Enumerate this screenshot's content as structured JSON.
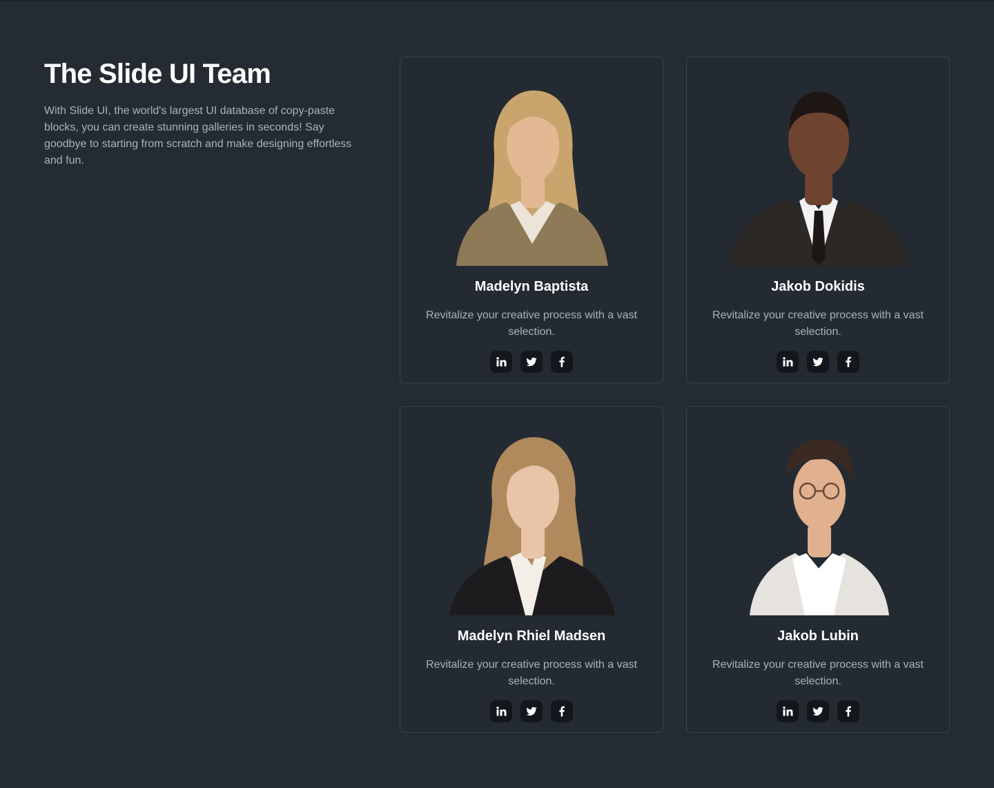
{
  "header": {
    "title": "The Slide UI Team",
    "description": "With Slide UI, the world's largest UI database of copy-paste blocks, you can create stunning galleries in seconds! Say goodbye to starting from scratch and make designing effortless and fun."
  },
  "team": [
    {
      "name": "Madelyn Baptista",
      "description": "Revitalize your creative process with a vast selection.",
      "portrait": {
        "hair": "#c9a56d",
        "skin": "#e3b994",
        "clothing": "#8e7a57",
        "inner": "#ece4d8"
      }
    },
    {
      "name": "Jakob Dokidis",
      "description": "Revitalize your creative process with a vast selection.",
      "portrait": {
        "hair": "#1d1612",
        "skin": "#6e4330",
        "clothing": "#2b2826",
        "inner": "#f2f2f2"
      }
    },
    {
      "name": "Madelyn Rhiel Madsen",
      "description": "Revitalize your creative process with a vast selection.",
      "portrait": {
        "hair": "#b08a5c",
        "skin": "#e8c4a8",
        "clothing": "#1c1c1e",
        "inner": "#f3efe8"
      }
    },
    {
      "name": "Jakob Lubin",
      "description": "Revitalize your creative process with a vast selection.",
      "portrait": {
        "hair": "#3a2a22",
        "skin": "#e0b08f",
        "clothing": "#e6e3de",
        "inner": "#ffffff"
      }
    }
  ],
  "socials": [
    "linkedin-icon",
    "twitter-icon",
    "facebook-icon"
  ],
  "colors": {
    "background": "#252b32",
    "card_border": "#3a424c",
    "heading": "#ffffff",
    "body_text": "#aab2bd",
    "icon_button_bg": "#13171c"
  }
}
